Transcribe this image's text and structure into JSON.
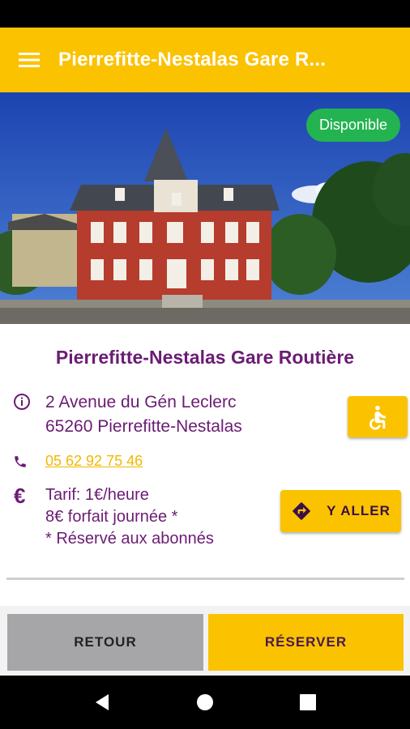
{
  "app_bar": {
    "title": "Pierrefitte-Nestalas Gare R..."
  },
  "hero": {
    "status_badge": "Disponible"
  },
  "place": {
    "title": "Pierrefitte-Nestalas Gare Routière",
    "address_line1": "2 Avenue du Gén Leclerc",
    "address_line2": "65260 Pierrefitte-Nestalas",
    "phone": "05 62 92 75 46",
    "tarif_line1": "Tarif: 1€/heure",
    "tarif_line2": "8€ forfait journée *",
    "tarif_line3": "* Réservé aux abonnés",
    "euro_symbol": "€"
  },
  "actions": {
    "go_label": "Y ALLER",
    "back_label": "RETOUR",
    "reserve_label": "RÉSERVER"
  },
  "colors": {
    "accent": "#fbc200",
    "brand": "#6b1c74",
    "available": "#24b351",
    "secondary": "#a6a6a9"
  }
}
